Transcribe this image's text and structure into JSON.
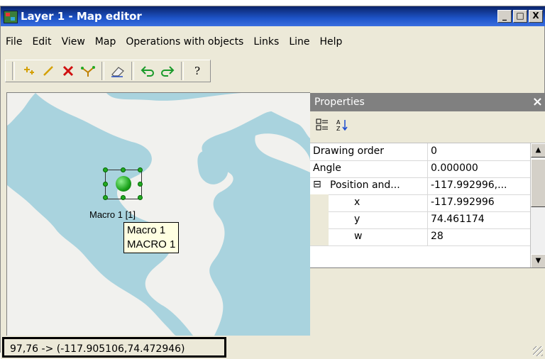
{
  "window": {
    "title": "Layer 1 - Map editor",
    "controls": {
      "minimize": "_",
      "maximize": "□",
      "close": "X"
    }
  },
  "menu": [
    "File",
    "Edit",
    "View",
    "Map",
    "Operations with objects",
    "Links",
    "Line",
    "Help"
  ],
  "toolbar": {
    "icons": [
      "add-point-icon",
      "draw-line-icon",
      "delete-icon",
      "edit-vertices-icon",
      "eraser-icon",
      "undo-icon",
      "redo-icon",
      "help-icon"
    ],
    "help_label": "?"
  },
  "map": {
    "object": {
      "label": "Macro 1 [1]",
      "tooltip_line1": "Macro 1",
      "tooltip_line2": "MACRO 1"
    }
  },
  "properties": {
    "title": "Properties",
    "close": "×",
    "rows": [
      {
        "name": "Drawing order",
        "value": "0"
      },
      {
        "name": "Angle",
        "value": "0.000000"
      },
      {
        "name": "Position and...",
        "value": "-117.992996,...",
        "expand": "⊟"
      },
      {
        "name": "x",
        "value": "-117.992996"
      },
      {
        "name": "y",
        "value": "74.461174"
      },
      {
        "name": "w",
        "value": "28"
      }
    ]
  },
  "statusbar": {
    "coords": "97,76 -> (-117.905106,74.472946)"
  },
  "colors": {
    "map_water": "#a9d3de",
    "map_land": "#f1f1ee",
    "title_bar": "#0a246a",
    "macro_ball": "#1ba21b"
  }
}
